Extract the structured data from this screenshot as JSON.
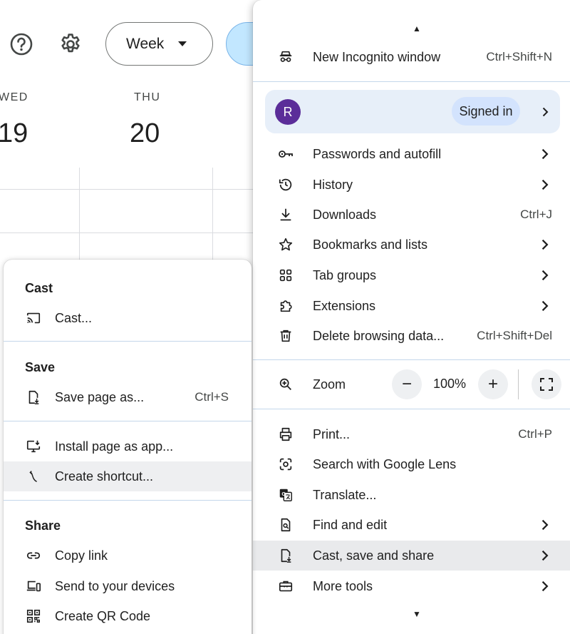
{
  "calendar": {
    "view_label": "Week",
    "days": [
      {
        "name": "WED",
        "number": "19"
      },
      {
        "name": "THU",
        "number": "20"
      }
    ]
  },
  "menu": {
    "incognito": {
      "label": "New Incognito window",
      "shortcut": "Ctrl+Shift+N"
    },
    "profile": {
      "initial": "R",
      "status": "Signed in"
    },
    "passwords": {
      "label": "Passwords and autofill"
    },
    "history": {
      "label": "History"
    },
    "downloads": {
      "label": "Downloads",
      "shortcut": "Ctrl+J"
    },
    "bookmarks": {
      "label": "Bookmarks and lists"
    },
    "tab_groups": {
      "label": "Tab groups"
    },
    "extensions": {
      "label": "Extensions"
    },
    "delete_data": {
      "label": "Delete browsing data...",
      "shortcut": "Ctrl+Shift+Del"
    },
    "zoom": {
      "label": "Zoom",
      "value": "100%",
      "minus": "−",
      "plus": "+"
    },
    "print": {
      "label": "Print...",
      "shortcut": "Ctrl+P"
    },
    "lens": {
      "label": "Search with Google Lens"
    },
    "translate": {
      "label": "Translate..."
    },
    "find_edit": {
      "label": "Find and edit"
    },
    "cast_save_share": {
      "label": "Cast, save and share"
    },
    "more_tools": {
      "label": "More tools"
    }
  },
  "submenu": {
    "cast_header": "Cast",
    "cast": {
      "label": "Cast..."
    },
    "save_header": "Save",
    "save_page": {
      "label": "Save page as...",
      "shortcut": "Ctrl+S"
    },
    "install_app": {
      "label": "Install page as app..."
    },
    "create_shortcut": {
      "label": "Create shortcut..."
    },
    "share_header": "Share",
    "copy_link": {
      "label": "Copy link"
    },
    "send_devices": {
      "label": "Send to your devices"
    },
    "qr_code": {
      "label": "Create QR Code"
    }
  },
  "colors": {
    "avatar": "#5b2d99",
    "profile_bg": "#e7eff9",
    "signed_pill": "#d3e3fd",
    "highlight": "#e9eaec",
    "accent_button": "#c2e7ff"
  }
}
